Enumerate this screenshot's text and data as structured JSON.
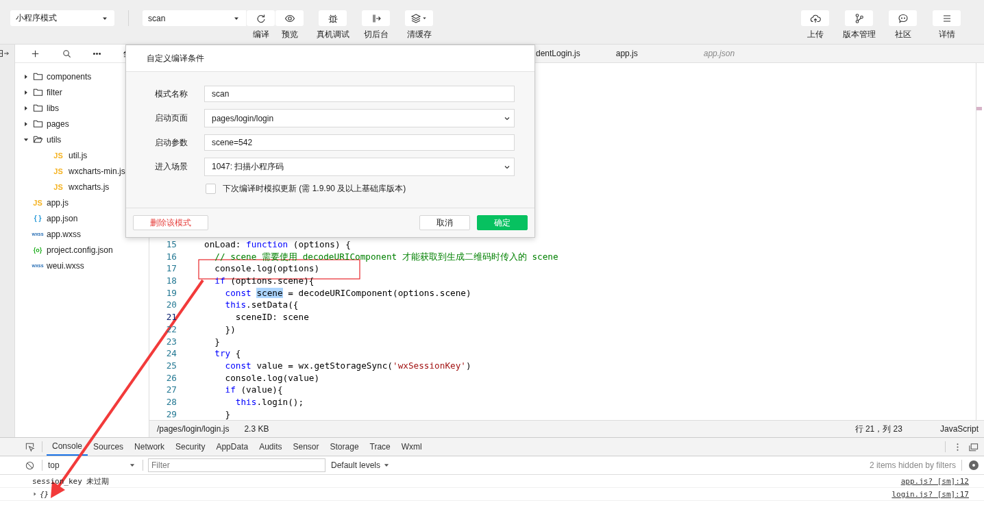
{
  "toolbar": {
    "mode_select": {
      "value": "小程序模式"
    },
    "compile_select": {
      "value": "scan"
    },
    "left_tools": [
      {
        "kind": "refresh",
        "label": "编译"
      },
      {
        "kind": "eye",
        "label": "预览"
      },
      {
        "kind": "bug",
        "label": "真机调试"
      },
      {
        "kind": "exit",
        "label": "切后台"
      },
      {
        "kind": "layers",
        "label": "清缓存"
      }
    ],
    "right_tools": [
      {
        "kind": "cloud",
        "label": "上传"
      },
      {
        "kind": "branch",
        "label": "版本管理"
      },
      {
        "kind": "chat",
        "label": "社区"
      },
      {
        "kind": "menu",
        "label": "详情"
      }
    ]
  },
  "file_tree": {
    "items": [
      {
        "kind": "folder",
        "name": "components",
        "expanded": false
      },
      {
        "kind": "folder",
        "name": "filter",
        "expanded": false
      },
      {
        "kind": "folder",
        "name": "libs",
        "expanded": false
      },
      {
        "kind": "folder",
        "name": "pages",
        "expanded": false
      },
      {
        "kind": "folder",
        "name": "utils",
        "expanded": true,
        "children": [
          {
            "kind": "js",
            "badge": "JS",
            "name": "util.js"
          },
          {
            "kind": "js",
            "badge": "JS",
            "name": "wxcharts-min.js"
          },
          {
            "kind": "js",
            "badge": "JS",
            "name": "wxcharts.js"
          }
        ]
      },
      {
        "kind": "js",
        "badge": "JS",
        "name": "app.js"
      },
      {
        "kind": "json",
        "badge": "{ }",
        "name": "app.json"
      },
      {
        "kind": "wxss",
        "badge": "wxss",
        "name": "app.wxss"
      },
      {
        "kind": "config",
        "badge": "{o}",
        "name": "project.config.json"
      },
      {
        "kind": "wxss",
        "badge": "wxss",
        "name": "weui.wxss"
      }
    ]
  },
  "editor": {
    "tabs": [
      {
        "label": "dentLogin.js",
        "selected": false,
        "preview": false
      },
      {
        "label": "app.js",
        "selected": false,
        "preview": false
      },
      {
        "label": "app.json",
        "selected": false,
        "preview": true
      }
    ],
    "lines": [
      {
        "number": "15",
        "current": false,
        "tokens": [
          {
            "kind": "plain",
            "text": "onLoad: "
          },
          {
            "kind": "keyword",
            "text": "function"
          },
          {
            "kind": "plain",
            "text": " (options) {"
          }
        ]
      },
      {
        "number": "16",
        "current": false,
        "tokens": [
          {
            "kind": "comment",
            "text": "  // scene 需要使用 decodeURIComponent 才能获取到生成二维码时传入的 scene"
          }
        ]
      },
      {
        "number": "17",
        "current": false,
        "tokens": [
          {
            "kind": "plain",
            "text": "  console.log(options)"
          }
        ]
      },
      {
        "number": "18",
        "current": false,
        "tokens": [
          {
            "kind": "keyword",
            "text": "  if"
          },
          {
            "kind": "plain",
            "text": " (options.scene){"
          }
        ]
      },
      {
        "number": "19",
        "current": false,
        "tokens": [
          {
            "kind": "keyword",
            "text": "    const "
          },
          {
            "kind": "match",
            "text": "scene"
          },
          {
            "kind": "plain",
            "text": " = decodeURIComponent(options.scene)"
          }
        ]
      },
      {
        "number": "20",
        "current": false,
        "tokens": [
          {
            "kind": "keyword",
            "text": "    this"
          },
          {
            "kind": "plain",
            "text": ".setData({"
          }
        ]
      },
      {
        "number": "21",
        "current": true,
        "tokens": [
          {
            "kind": "plain",
            "text": "      sceneID: scene"
          }
        ]
      },
      {
        "number": "22",
        "current": false,
        "tokens": [
          {
            "kind": "plain",
            "text": "    })"
          }
        ]
      },
      {
        "number": "23",
        "current": false,
        "tokens": [
          {
            "kind": "plain",
            "text": "  }"
          }
        ]
      },
      {
        "number": "24",
        "current": false,
        "tokens": [
          {
            "kind": "keyword",
            "text": "  try"
          },
          {
            "kind": "plain",
            "text": " {"
          }
        ]
      },
      {
        "number": "25",
        "current": false,
        "tokens": [
          {
            "kind": "keyword",
            "text": "    const"
          },
          {
            "kind": "plain",
            "text": " value = wx.getStorageSync("
          },
          {
            "kind": "string",
            "text": "'wxSessionKey'"
          },
          {
            "kind": "plain",
            "text": ")"
          }
        ]
      },
      {
        "number": "26",
        "current": false,
        "tokens": [
          {
            "kind": "plain",
            "text": "    console.log(value)"
          }
        ]
      },
      {
        "number": "27",
        "current": false,
        "tokens": [
          {
            "kind": "keyword",
            "text": "    if"
          },
          {
            "kind": "plain",
            "text": " (value){"
          }
        ]
      },
      {
        "number": "28",
        "current": false,
        "tokens": [
          {
            "kind": "keyword",
            "text": "      this"
          },
          {
            "kind": "plain",
            "text": ".login();"
          }
        ]
      },
      {
        "number": "29",
        "current": false,
        "tokens": [
          {
            "kind": "plain",
            "text": "    }"
          }
        ]
      }
    ]
  },
  "status_bar": {
    "path": "/pages/login/login.js",
    "size": "2.3 KB",
    "position": "行 21，列 23",
    "language": "JavaScript"
  },
  "dialog": {
    "title": "自定义编译条件",
    "fields": [
      {
        "kind": "text",
        "label": "模式名称",
        "value": "scan"
      },
      {
        "kind": "select",
        "label": "启动页面",
        "value": "pages/login/login"
      },
      {
        "kind": "text",
        "label": "启动参数",
        "value": "scene=542"
      },
      {
        "kind": "select",
        "label": "进入场景",
        "value": "1047: 扫描小程序码"
      }
    ],
    "checkbox": {
      "label": "下次编译时模拟更新 (需 1.9.90 及以上基础库版本)",
      "checked": false
    },
    "buttons": [
      {
        "kind": "danger",
        "label": "删除该模式"
      },
      {
        "kind": "default",
        "label": "取消"
      },
      {
        "kind": "primary",
        "label": "确定"
      }
    ]
  },
  "devtools": {
    "tabs": [
      {
        "label": "Console",
        "selected": true
      },
      {
        "label": "Sources",
        "selected": false
      },
      {
        "label": "Network",
        "selected": false
      },
      {
        "label": "Security",
        "selected": false
      },
      {
        "label": "AppData",
        "selected": false
      },
      {
        "label": "Audits",
        "selected": false
      },
      {
        "label": "Sensor",
        "selected": false
      },
      {
        "label": "Storage",
        "selected": false
      },
      {
        "label": "Trace",
        "selected": false
      },
      {
        "label": "Wxml",
        "selected": false
      }
    ],
    "context_select": {
      "value": "top"
    },
    "filter": {
      "placeholder": "Filter"
    },
    "levels": {
      "label": "Default levels"
    },
    "hidden_note": "2 items hidden by filters",
    "messages": [
      {
        "kind": "text",
        "text": "session_key 未过期",
        "source": "app.js? [sm]:12"
      },
      {
        "kind": "object",
        "text": "{}",
        "source": "login.js? [sm]:17",
        "expanded": false
      }
    ]
  }
}
